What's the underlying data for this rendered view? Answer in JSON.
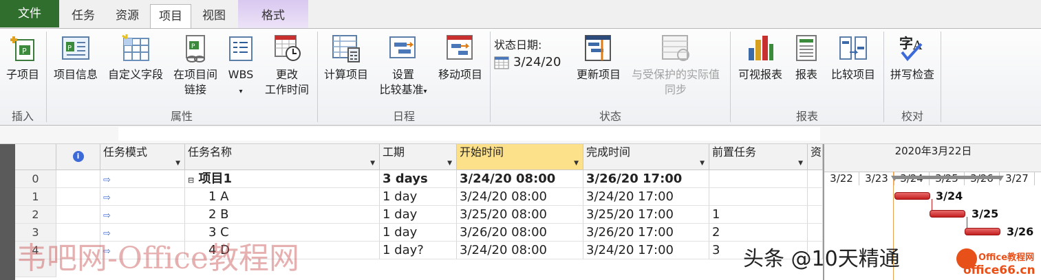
{
  "tabs": {
    "file": "文件",
    "task": "任务",
    "resource": "资源",
    "project": "项目",
    "view": "视图",
    "format": "格式"
  },
  "ribbon": {
    "insert": {
      "label": "插入",
      "subproject": "子项目"
    },
    "properties": {
      "label": "属性",
      "project_info": "项目信息",
      "custom_fields": "自定义字段",
      "links_line1": "在项目间",
      "links_line2": "链接",
      "wbs": "WBS",
      "worktime_line1": "更改",
      "worktime_line2": "工作时间"
    },
    "schedule": {
      "label": "日程",
      "calc": "计算项目",
      "baseline_line1": "设置",
      "baseline_line2": "比较基准",
      "move": "移动项目"
    },
    "status": {
      "label": "状态",
      "status_date_label": "状态日期:",
      "status_date_value": "3/24/20",
      "update": "更新项目",
      "sync_line1": "与受保护的实际值",
      "sync_line2": "同步"
    },
    "reports": {
      "label": "报表",
      "visual": "可视报表",
      "reports": "报表",
      "compare": "比较项目"
    },
    "proofing": {
      "label": "校对",
      "spelling": "拼写检查"
    }
  },
  "grid": {
    "headers": {
      "mode": "任务模式",
      "name": "任务名称",
      "duration": "工期",
      "start": "开始时间",
      "finish": "完成时间",
      "pred": "前置任务",
      "res": "资"
    },
    "rows": [
      {
        "id": "0",
        "name": "项目1",
        "duration": "3 days",
        "start": "3/24/20 08:00",
        "finish": "3/26/20 17:00",
        "pred": ""
      },
      {
        "id": "1",
        "name": "1 A",
        "duration": "1 day",
        "start": "3/24/20 08:00",
        "finish": "3/24/20 17:00",
        "pred": ""
      },
      {
        "id": "2",
        "name": "2 B",
        "duration": "1 day",
        "start": "3/25/20 08:00",
        "finish": "3/25/20 17:00",
        "pred": "1"
      },
      {
        "id": "3",
        "name": "3 C",
        "duration": "1 day",
        "start": "3/26/20 08:00",
        "finish": "3/26/20 17:00",
        "pred": "2"
      },
      {
        "id": "4",
        "name": "4 D",
        "duration": "1 day?",
        "start": "3/24/20 08:00",
        "finish": "3/24/20 17:00",
        "pred": "3"
      }
    ]
  },
  "gantt": {
    "week": "2020年3月22日",
    "days": [
      "3/22",
      "3/23",
      "3/24",
      "3/25",
      "3/26",
      "3/27"
    ],
    "bar_labels": [
      "3/24",
      "3/25",
      "3/26"
    ]
  },
  "watermarks": {
    "left": "韦吧网-Office教程网",
    "right": "头条 @10天精通",
    "logo": "office66.cn",
    "logo_top": "Office教程网"
  }
}
